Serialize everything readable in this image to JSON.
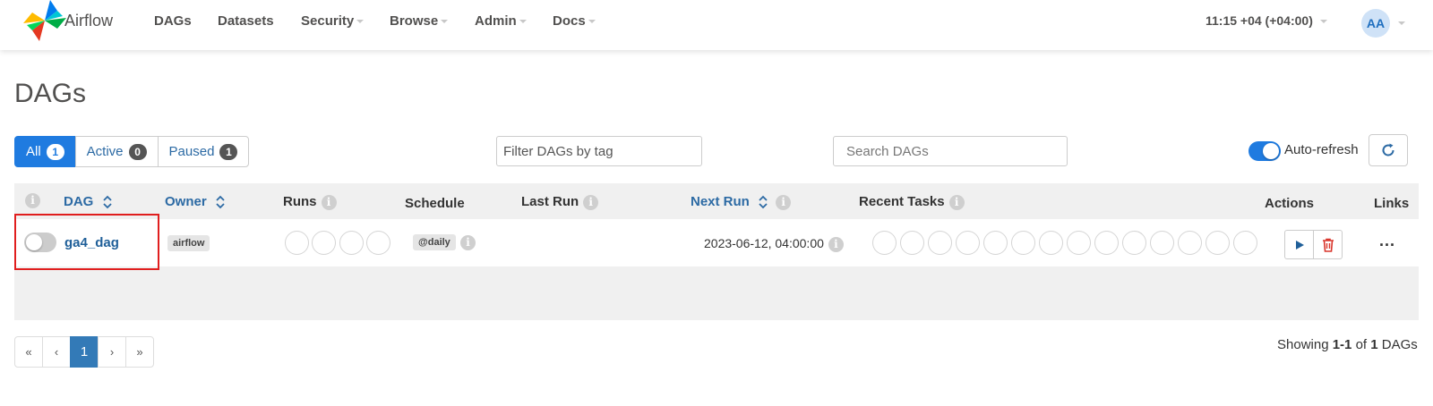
{
  "navbar": {
    "brand": "Airflow",
    "items": [
      {
        "label": "DAGs",
        "dropdown": false
      },
      {
        "label": "Datasets",
        "dropdown": false
      },
      {
        "label": "Security",
        "dropdown": true
      },
      {
        "label": "Browse",
        "dropdown": true
      },
      {
        "label": "Admin",
        "dropdown": true
      },
      {
        "label": "Docs",
        "dropdown": true
      }
    ],
    "clock": "11:15 +04 (+04:00)",
    "avatar_initials": "AA"
  },
  "page": {
    "title": "DAGs"
  },
  "filters": {
    "all": {
      "label": "All",
      "count": "1"
    },
    "active": {
      "label": "Active",
      "count": "0"
    },
    "paused": {
      "label": "Paused",
      "count": "1"
    },
    "tag_placeholder": "Filter DAGs by tag",
    "search_placeholder": "Search DAGs",
    "auto_refresh_label": "Auto-refresh",
    "auto_refresh_on": true
  },
  "table": {
    "headers": {
      "dag": "DAG",
      "owner": "Owner",
      "runs": "Runs",
      "schedule": "Schedule",
      "last_run": "Last Run",
      "next_run": "Next Run",
      "recent_tasks": "Recent Tasks",
      "actions": "Actions",
      "links": "Links"
    },
    "rows": [
      {
        "dag_id": "ga4_dag",
        "paused": true,
        "owner": "airflow",
        "schedule": "@daily",
        "last_run": "",
        "next_run": "2023-06-12, 04:00:00",
        "links_label": "..."
      }
    ]
  },
  "pagination": {
    "first": "«",
    "prev": "‹",
    "current": "1",
    "next": "›",
    "last": "»"
  },
  "footer": {
    "showing_prefix": "Showing",
    "range": "1-1",
    "of": "of",
    "total": "1",
    "suffix": "DAGs"
  },
  "colors": {
    "accent": "#1f7be0",
    "link": "#2c6aa4",
    "highlight": "#e01e1e",
    "delete": "#d9362c"
  }
}
